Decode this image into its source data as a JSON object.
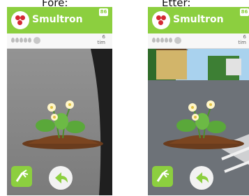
{
  "captions": {
    "before": "Före:",
    "after": "Etter:"
  },
  "app": {
    "title": "Smultron",
    "badge": "86",
    "time_value": "6",
    "time_unit": "tim"
  },
  "icons": {
    "logo": "strawberry-logo-icon",
    "water": "water-drop-icon",
    "rake": "rake-icon",
    "back": "back-arrow-icon"
  },
  "colors": {
    "brand_green": "#8ccf3f",
    "berry_red": "#d42a34"
  }
}
